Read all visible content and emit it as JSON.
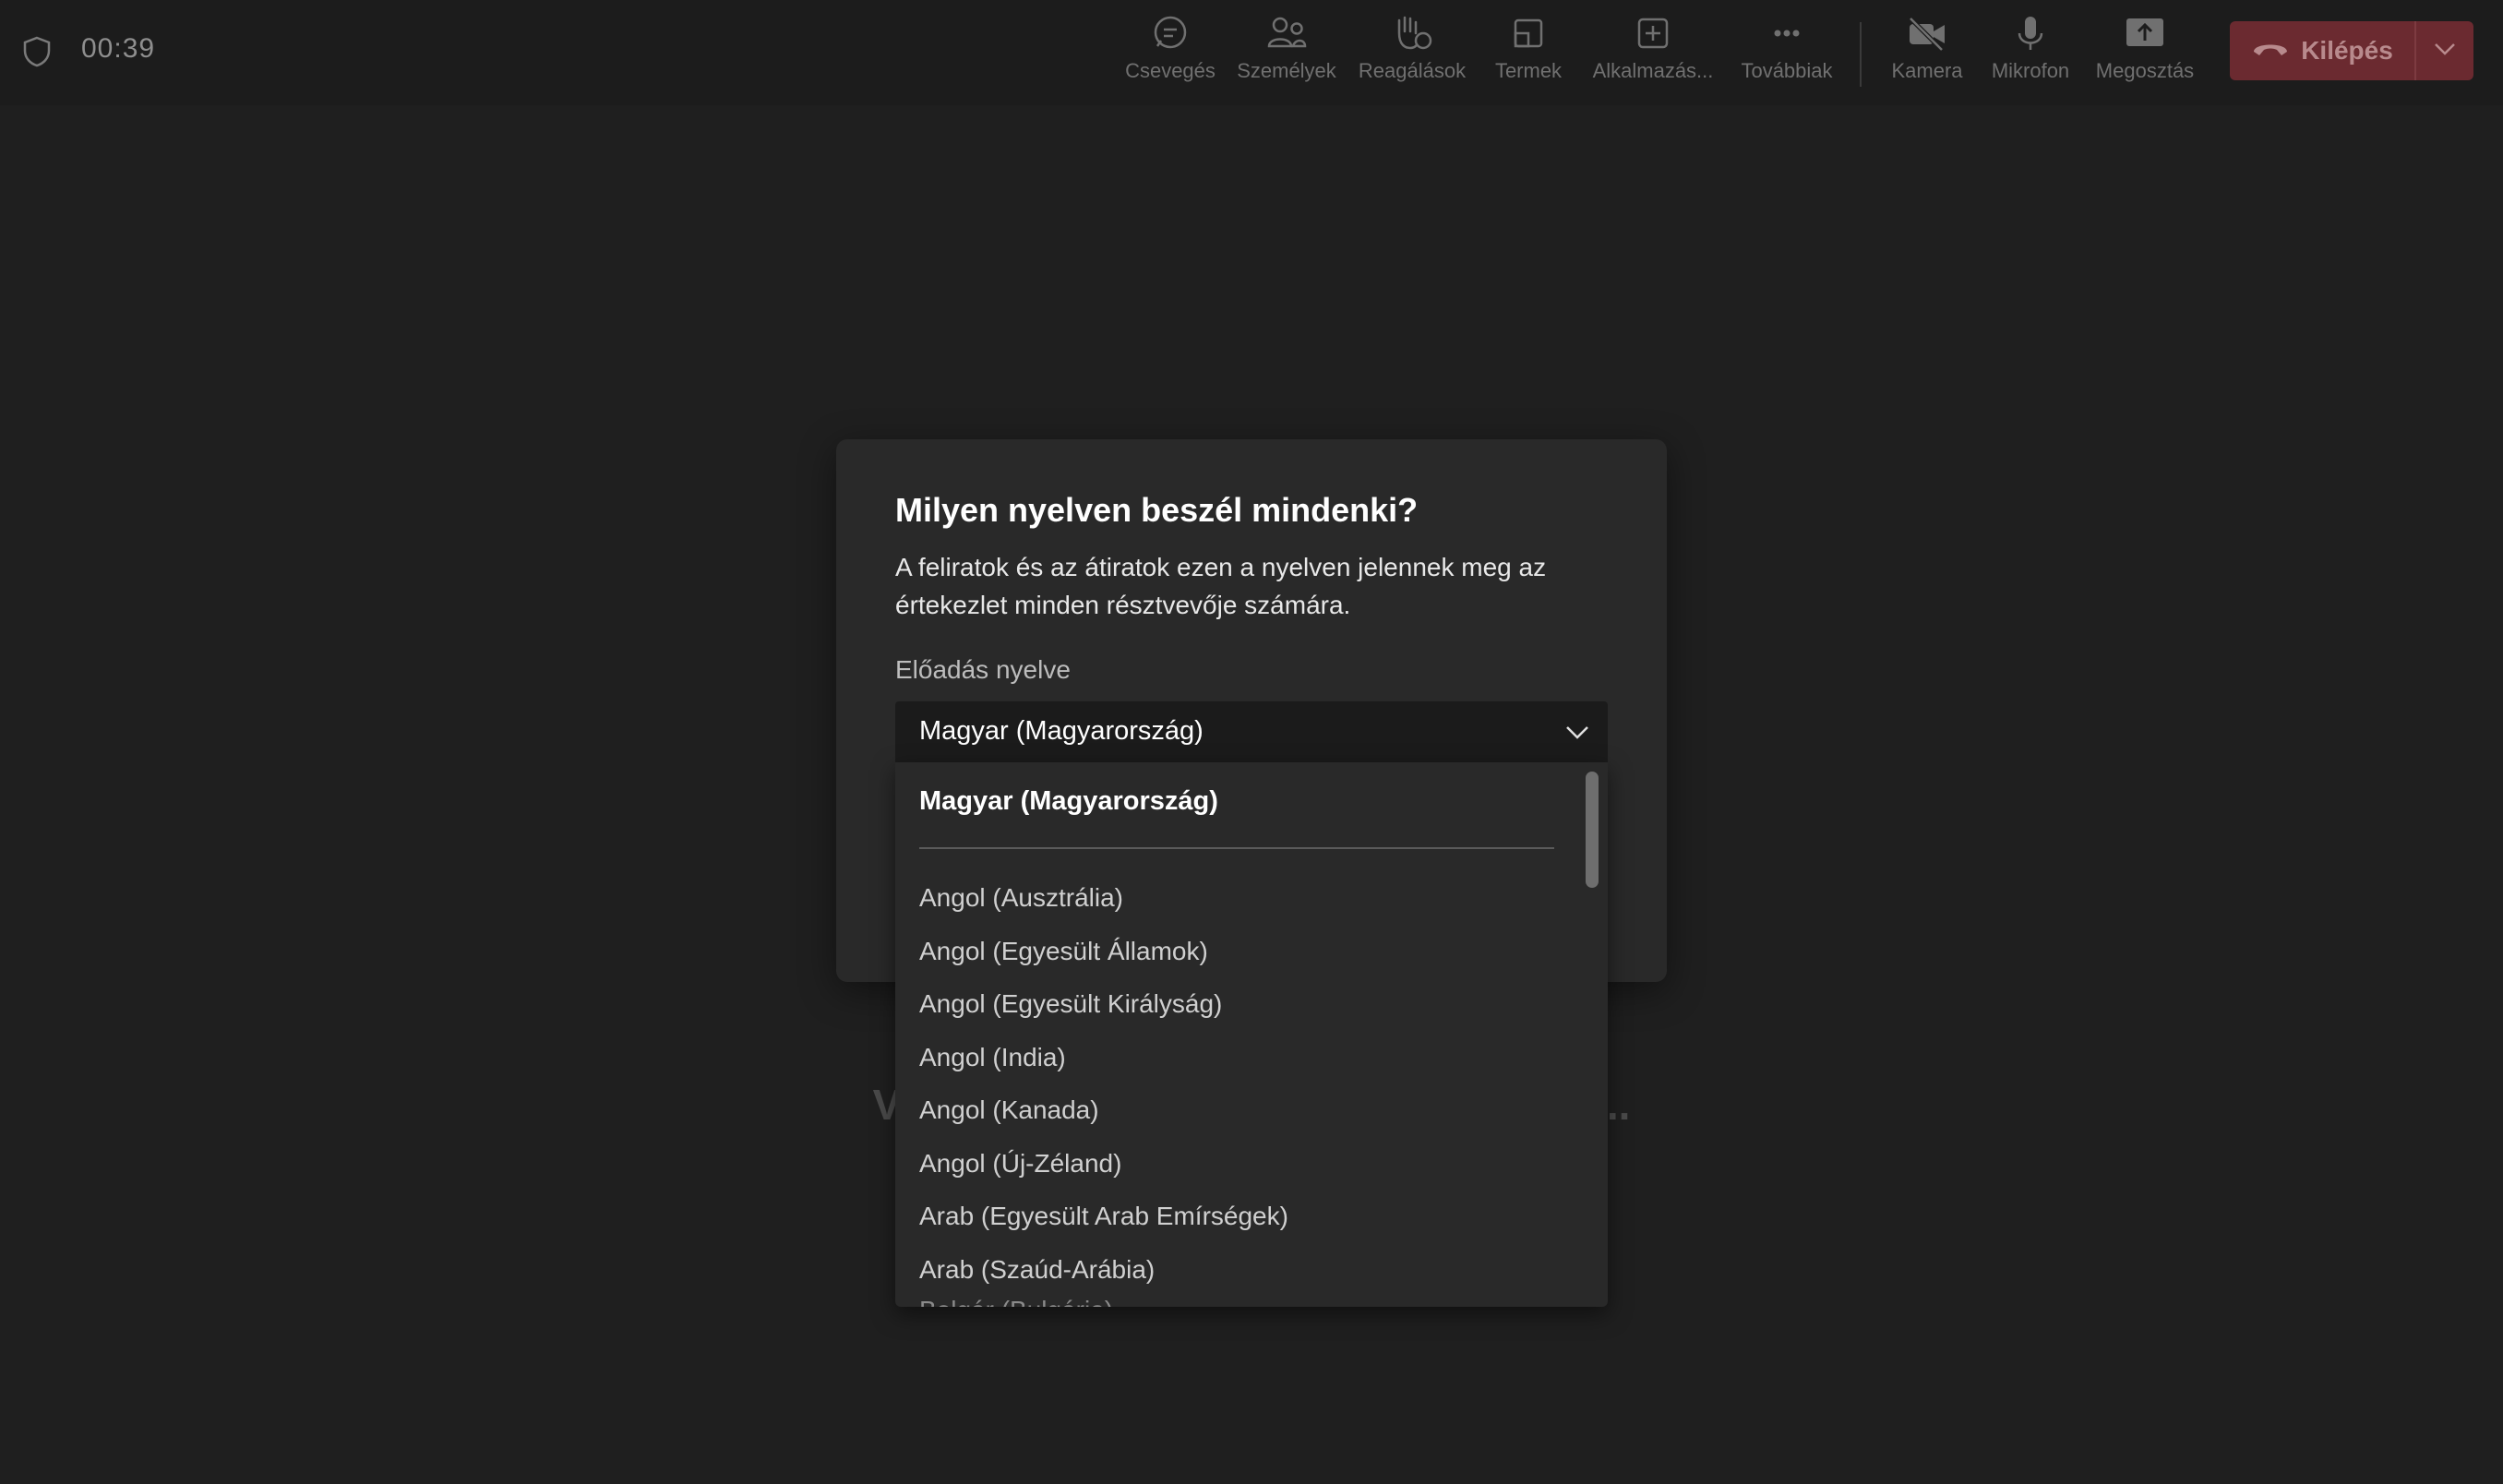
{
  "topbar": {
    "timer": "00:39",
    "items": [
      {
        "label": "Csevegés",
        "icon": "chat-icon"
      },
      {
        "label": "Személyek",
        "icon": "people-icon"
      },
      {
        "label": "Reagálások",
        "icon": "raise-hand-icon"
      },
      {
        "label": "Termek",
        "icon": "rooms-icon"
      },
      {
        "label": "Alkalmazás...",
        "icon": "add-app-icon"
      },
      {
        "label": "Továbbiak",
        "icon": "more-icon"
      },
      {
        "label": "Kamera",
        "icon": "camera-off-icon"
      },
      {
        "label": "Mikrofon",
        "icon": "microphone-icon"
      },
      {
        "label": "Megosztás",
        "icon": "share-icon"
      }
    ],
    "leave_label": "Kilépés"
  },
  "stage": {
    "waiting_text": "Várakozás a többiek csatlakozására..."
  },
  "dialog": {
    "title": "Milyen nyelven beszél mindenki?",
    "description": "A feliratok és az átiratok ezen a nyelven jelennek meg az értekezlet minden résztvevője számára.",
    "field_label": "Előadás nyelve",
    "selected_value": "Magyar (Magyarország)",
    "options": [
      "Angol (Ausztrália)",
      "Angol (Egyesült Államok)",
      "Angol (Egyesült Királyság)",
      "Angol (India)",
      "Angol (Kanada)",
      "Angol (Új-Zéland)",
      "Arab (Egyesült Arab Emírségek)",
      "Arab (Szaúd-Arábia)"
    ],
    "partial_option": "Bolgár (Bulgária)"
  },
  "colors": {
    "background": "#1f1f1f",
    "dialog": "#292929",
    "leave_button": "#6b2a30"
  }
}
